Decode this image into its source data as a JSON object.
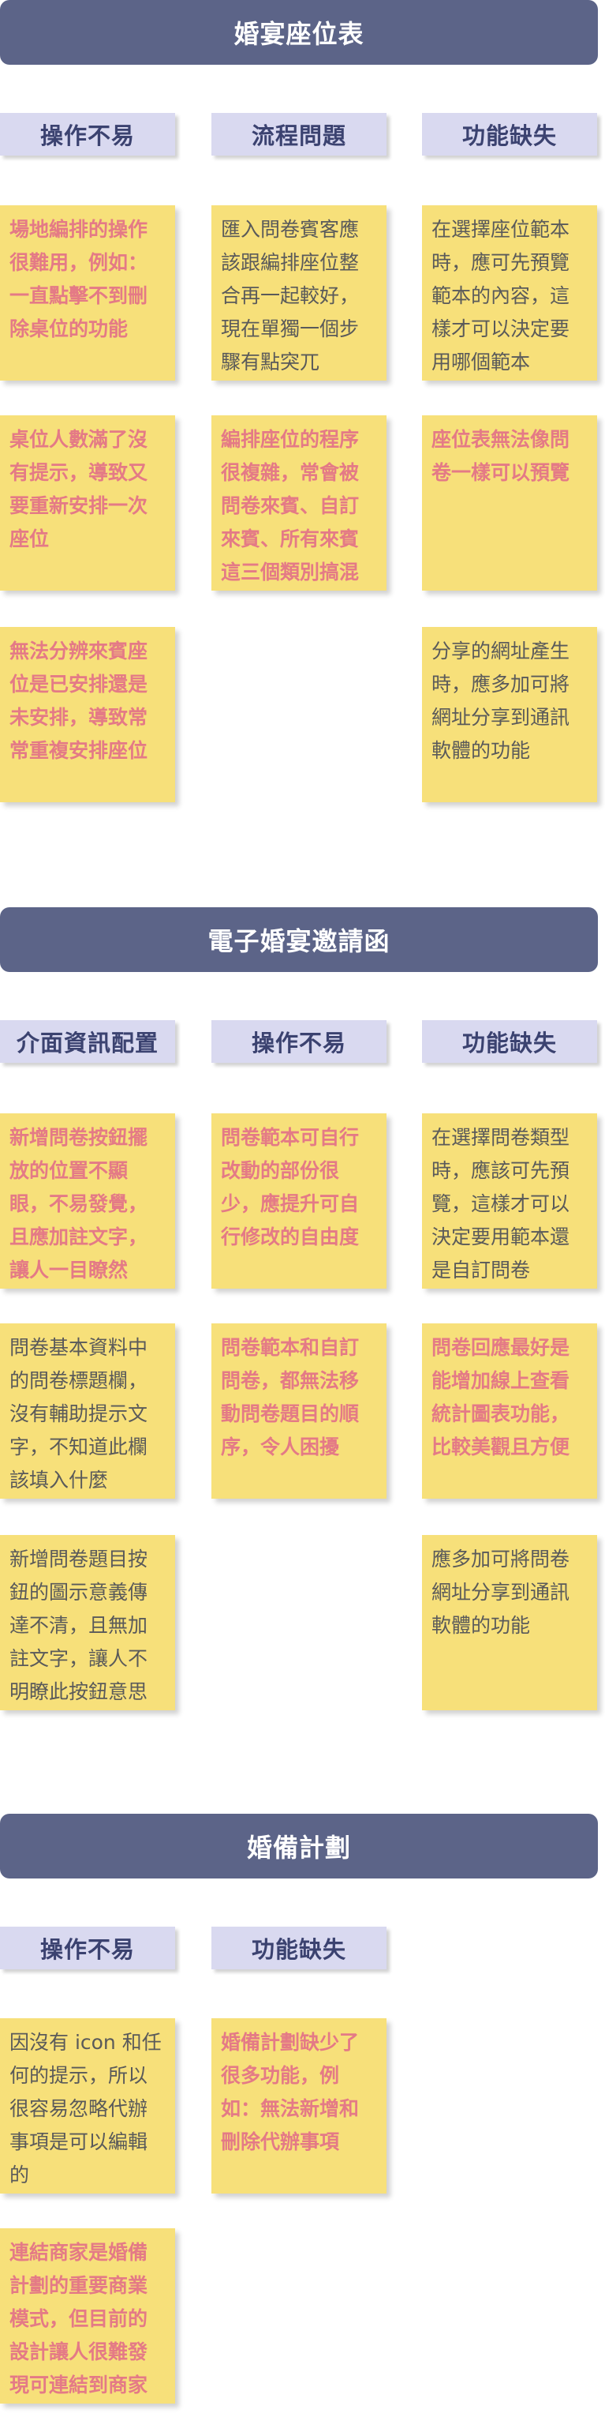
{
  "sections": [
    {
      "title": "婚宴座位表",
      "headers": [
        "操作不易",
        "流程問題",
        "功能缺失"
      ],
      "notes": [
        {
          "text": "場地編排的操作很難用，例如：一直點擊不到刪除桌位的功能",
          "style": "pink"
        },
        {
          "text": "匯入問卷賓客應該跟編排座位整合再一起較好，現在單獨一個步驟有點突兀",
          "style": "gray"
        },
        {
          "text": "在選擇座位範本時，應可先預覽範本的內容，這樣才可以決定要用哪個範本",
          "style": "gray"
        },
        {
          "text": "桌位人數滿了沒有提示，導致又要重新安排一次座位",
          "style": "pink"
        },
        {
          "text": "編排座位的程序很複雜，常會被問卷來賓、自訂來賓、所有來賓這三個類別搞混",
          "style": "pink"
        },
        {
          "text": "座位表無法像問卷一樣可以預覽",
          "style": "pink"
        },
        {
          "text": "無法分辨來賓座位是已安排還是未安排，導致常常重複安排座位",
          "style": "pink"
        },
        {
          "text": "分享的網址產生時，應多加可將網址分享到通訊軟體的功能",
          "style": "gray"
        }
      ]
    },
    {
      "title": "電子婚宴邀請函",
      "headers": [
        "介面資訊配置",
        "操作不易",
        "功能缺失"
      ],
      "notes": [
        {
          "text": "新增問卷按鈕擺放的位置不顯眼，不易發覺，且應加註文字，讓人一目瞭然",
          "style": "pink"
        },
        {
          "text": "問卷範本可自行改動的部份很少，應提升可自行修改的自由度",
          "style": "pink"
        },
        {
          "text": "在選擇問卷類型時，應該可先預覽，這樣才可以決定要用範本還是自訂問卷",
          "style": "gray"
        },
        {
          "text": "問卷基本資料中的問卷標題欄，沒有輔助提示文字，不知道此欄該填入什麼",
          "style": "gray"
        },
        {
          "text": "問卷範本和自訂問卷，都無法移動問卷題目的順序，令人困擾",
          "style": "pink"
        },
        {
          "text": "問卷回應最好是能增加線上查看統計圖表功能，比較美觀且方便",
          "style": "pink"
        },
        {
          "text": "新增問卷題目按鈕的圖示意義傳達不清，且無加註文字，讓人不明瞭此按鈕意思",
          "style": "gray"
        },
        {
          "text": "應多加可將問卷網址分享到通訊軟體的功能",
          "style": "gray"
        }
      ]
    },
    {
      "title": "婚備計劃",
      "headers": [
        "操作不易",
        "功能缺失"
      ],
      "notes": [
        {
          "text": "因沒有 icon 和任何的提示，所以很容易忽略代辦事項是可以編輯的",
          "style": "gray"
        },
        {
          "text": "婚備計劃缺少了很多功能，例如：無法新增和刪除代辦事項",
          "style": "pink"
        },
        {
          "text": "連結商家是婚備計劃的重要商業模式，但目前的設計讓人很難發現可連結到商家",
          "style": "pink"
        }
      ]
    }
  ]
}
